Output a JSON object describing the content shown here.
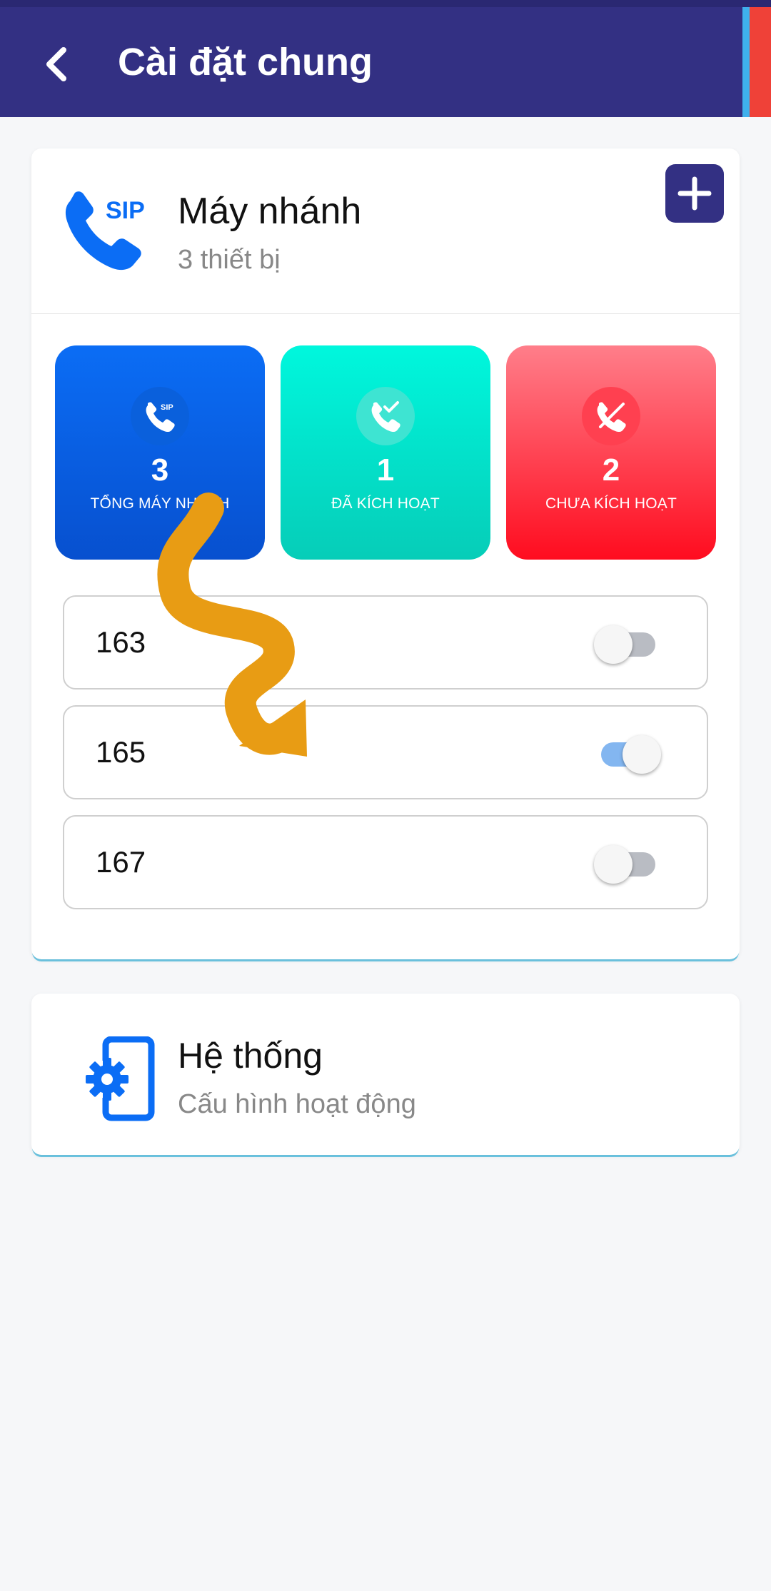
{
  "header": {
    "title": "Cài đặt chung",
    "back_icon": "chevron-left-icon",
    "colors": {
      "bar": "#333083",
      "edge_blue": "#3fb0ec",
      "edge_red": "#ef4138"
    }
  },
  "extensions": {
    "title": "Máy nhánh",
    "subtitle": "3 thiết bị",
    "icon_label": "SIP",
    "add_icon": "plus-icon",
    "stats": [
      {
        "value": "3",
        "label": "TỔNG MÁY NHÁNH",
        "icon": "sip-phone-icon",
        "color": "#0b6df5"
      },
      {
        "value": "1",
        "label": "ĐÃ KÍCH HOẠT",
        "icon": "phone-check-icon",
        "color": "#00e3c9"
      },
      {
        "value": "2",
        "label": "CHƯA KÍCH HOẠT",
        "icon": "phone-off-icon",
        "color": "#ff2436"
      }
    ],
    "items": [
      {
        "number": "163",
        "enabled": false
      },
      {
        "number": "165",
        "enabled": true
      },
      {
        "number": "167",
        "enabled": false
      }
    ]
  },
  "system": {
    "title": "Hệ thống",
    "subtitle": "Cấu hình hoạt động",
    "icon": "device-settings-icon"
  },
  "annotation": {
    "type": "arrow",
    "color": "#e89c14"
  }
}
